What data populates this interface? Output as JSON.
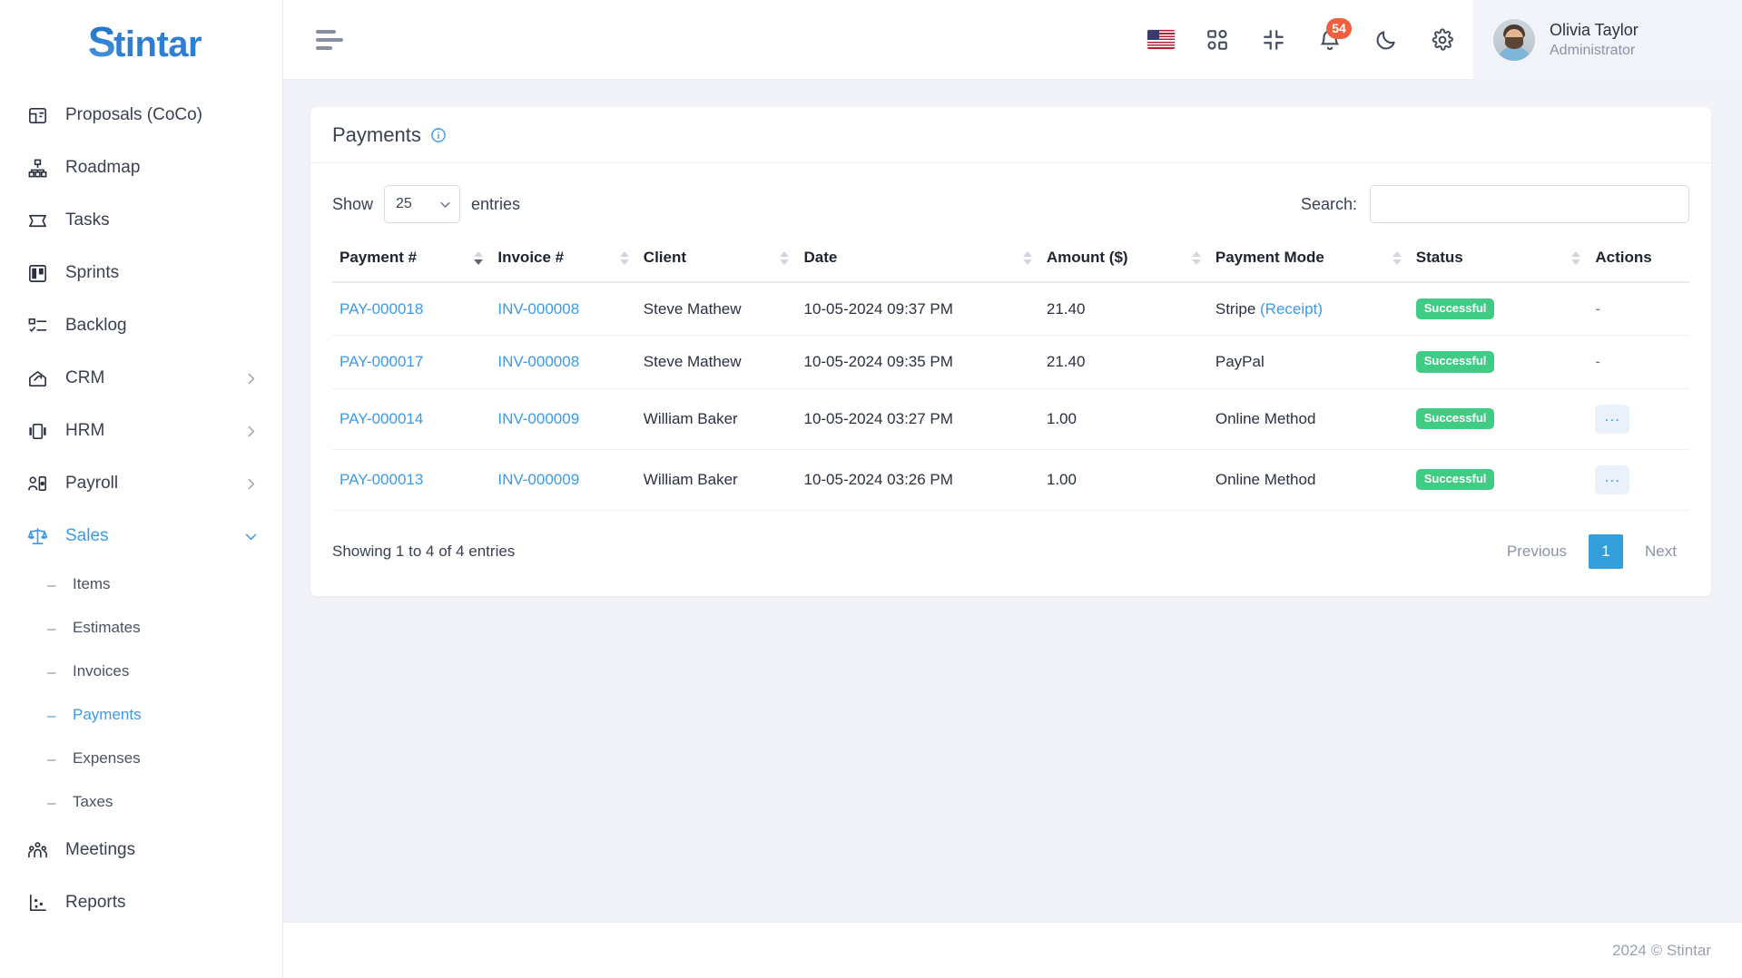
{
  "brand": {
    "prefix": "S",
    "rest": "tintar"
  },
  "sidebar": {
    "items": [
      {
        "label": "Proposals (CoCo)",
        "icon": "proposal-icon",
        "expandable": false
      },
      {
        "label": "Roadmap",
        "icon": "roadmap-icon",
        "expandable": false
      },
      {
        "label": "Tasks",
        "icon": "tasks-icon",
        "expandable": false
      },
      {
        "label": "Sprints",
        "icon": "sprints-icon",
        "expandable": false
      },
      {
        "label": "Backlog",
        "icon": "backlog-icon",
        "expandable": false
      },
      {
        "label": "CRM",
        "icon": "crm-icon",
        "expandable": true
      },
      {
        "label": "HRM",
        "icon": "hrm-icon",
        "expandable": true
      },
      {
        "label": "Payroll",
        "icon": "payroll-icon",
        "expandable": true
      },
      {
        "label": "Sales",
        "icon": "sales-icon",
        "expandable": true,
        "active": true
      },
      {
        "label": "Meetings",
        "icon": "meetings-icon",
        "expandable": false
      },
      {
        "label": "Reports",
        "icon": "reports-icon",
        "expandable": false
      }
    ],
    "sales_children": [
      {
        "label": "Items"
      },
      {
        "label": "Estimates"
      },
      {
        "label": "Invoices"
      },
      {
        "label": "Payments",
        "active": true
      },
      {
        "label": "Expenses"
      },
      {
        "label": "Taxes"
      }
    ]
  },
  "header": {
    "menu_toggle": "hamburger-icon",
    "icons": [
      {
        "name": "language-flag-icon",
        "label": "US"
      },
      {
        "name": "apps-grid-icon",
        "label": "Apps"
      },
      {
        "name": "fullscreen-exit-icon",
        "label": "Compress"
      },
      {
        "name": "bell-icon",
        "label": "Notifications",
        "badge": "54"
      },
      {
        "name": "moon-icon",
        "label": "Dark mode"
      },
      {
        "name": "gear-icon",
        "label": "Settings"
      }
    ],
    "notification_count": "54",
    "profile": {
      "name": "Olivia Taylor",
      "role": "Administrator"
    }
  },
  "page": {
    "title": "Payments",
    "info_icon": "info-circle-icon"
  },
  "table_tools": {
    "show_label": "Show",
    "entries_label": "entries",
    "page_length": "25",
    "search_label": "Search:",
    "search_value": "",
    "search_placeholder": ""
  },
  "table": {
    "columns": [
      {
        "label": "Payment #",
        "sorted": "desc"
      },
      {
        "label": "Invoice #",
        "sorted": "none"
      },
      {
        "label": "Client",
        "sorted": "none"
      },
      {
        "label": "Date",
        "sorted": "none"
      },
      {
        "label": "Amount ($)",
        "sorted": "none"
      },
      {
        "label": "Payment Mode",
        "sorted": "none"
      },
      {
        "label": "Status",
        "sorted": "none"
      },
      {
        "label": "Actions",
        "sorted": "none"
      }
    ],
    "rows": [
      {
        "payment": "PAY-000018",
        "invoice": "INV-000008",
        "client": "Steve Mathew",
        "date": "10-05-2024 09:37 PM",
        "amount": "21.40",
        "mode": "Stripe",
        "mode_link": "(Receipt)",
        "status": "Successful",
        "action": "-"
      },
      {
        "payment": "PAY-000017",
        "invoice": "INV-000008",
        "client": "Steve Mathew",
        "date": "10-05-2024 09:35 PM",
        "amount": "21.40",
        "mode": "PayPal",
        "mode_link": "",
        "status": "Successful",
        "action": "-"
      },
      {
        "payment": "PAY-000014",
        "invoice": "INV-000009",
        "client": "William Baker",
        "date": "10-05-2024 03:27 PM",
        "amount": "1.00",
        "mode": "Online Method",
        "mode_link": "",
        "status": "Successful",
        "action": "..."
      },
      {
        "payment": "PAY-000013",
        "invoice": "INV-000009",
        "client": "William Baker",
        "date": "10-05-2024 03:26 PM",
        "amount": "1.00",
        "mode": "Online Method",
        "mode_link": "",
        "status": "Successful",
        "action": "..."
      }
    ]
  },
  "footer_table": {
    "showing": "Showing 1 to 4 of 4 entries",
    "previous": "Previous",
    "page": "1",
    "next": "Next"
  },
  "footer": {
    "copyright": "2024 © Stintar"
  },
  "colors": {
    "accent": "#3c9ae8",
    "pagination_active": "#33a0dd",
    "status_success": "#41cc86",
    "badge": "#f0603f",
    "sidebar_bg": "#ffffff",
    "content_bg": "#f2f3f8"
  }
}
